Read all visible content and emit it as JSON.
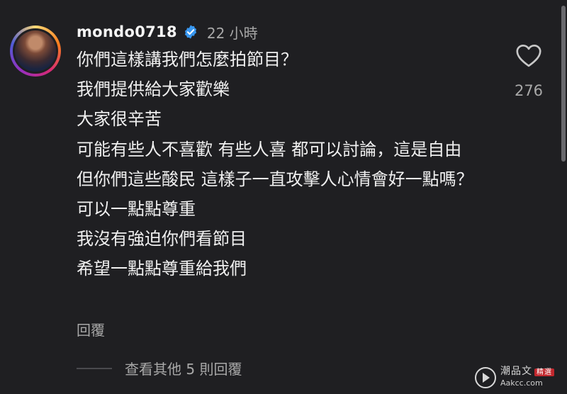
{
  "comment": {
    "username": "mondo0718",
    "time": "22 小時",
    "lines": [
      "你們這樣講我們怎麼拍節目？",
      "我們提供給大家歡樂",
      "大家很辛苦",
      "可能有些人不喜歡 有些人喜 都可以討論，這是自由",
      "但你們這些酸民 這樣子一直攻擊人心情會好一點嗎？",
      "可以一點點尊重",
      "我沒有強迫你們看節目",
      "希望一點點尊重給我們"
    ],
    "reply_label": "回覆",
    "like_count": "276",
    "more_replies": "查看其他 5 則回覆"
  },
  "watermark": {
    "name": "潮品文",
    "tag": "精選",
    "url": "Aakcc.com"
  },
  "colors": {
    "background": "#1f1f22",
    "verified": "#3897f0",
    "muted_text": "#a8a8a8"
  },
  "icons": [
    "verified-badge-icon",
    "heart-icon",
    "play-icon"
  ]
}
